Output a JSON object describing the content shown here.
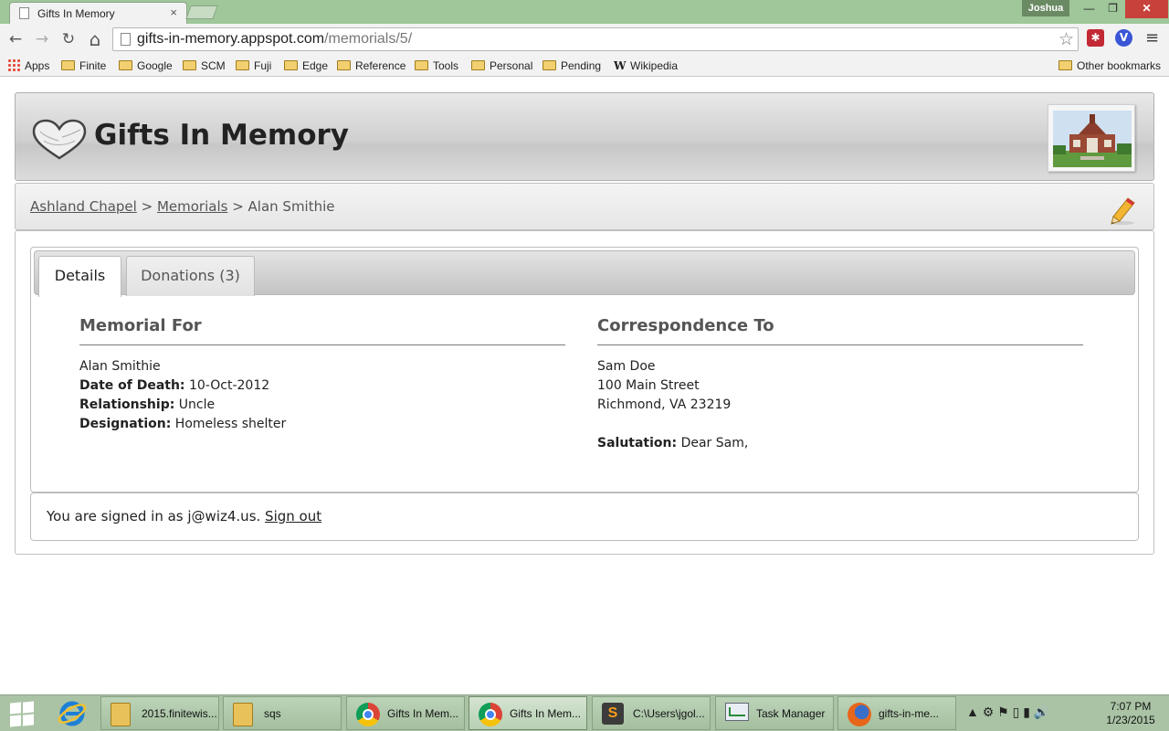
{
  "browser": {
    "tab_title": "Gifts In Memory",
    "tab_close": "×",
    "user": "Joshua",
    "window_controls": {
      "minimize": "—",
      "maximize": "❐",
      "close": "✕"
    },
    "nav": {
      "back": "←",
      "forward": "→",
      "reload": "↻",
      "home": "⌂"
    },
    "url_host": "gifts-in-memory.appspot.com",
    "url_path": "/memorials/5/",
    "star": "☆",
    "ext_red": "✱",
    "ext_blue": "V",
    "menu": "≡"
  },
  "bookmarks": {
    "apps": "Apps",
    "items": [
      "Finite",
      "Google",
      "SCM",
      "Fuji",
      "Edge",
      "Reference",
      "Tools",
      "Personal",
      "Pending"
    ],
    "wikipedia": "Wikipedia",
    "other": "Other bookmarks"
  },
  "header": {
    "title": "Gifts In Memory"
  },
  "breadcrumb": {
    "org": "Ashland Chapel",
    "sep1": " > ",
    "section": "Memorials",
    "sep2": " > ",
    "current": "Alan Smithie"
  },
  "tabs": {
    "details": "Details",
    "donations": "Donations (3)"
  },
  "memorial": {
    "heading": "Memorial For",
    "name": "Alan Smithie",
    "date_of_death_label": "Date of Death:",
    "date_of_death": " 10-Oct-2012",
    "relationship_label": "Relationship:",
    "relationship": " Uncle",
    "designation_label": "Designation:",
    "designation": " Homeless shelter"
  },
  "correspondence": {
    "heading": "Correspondence To",
    "name": "Sam Doe",
    "street": "100 Main Street",
    "city_state_zip": "Richmond, VA 23219",
    "salutation_label": "Salutation:",
    "salutation": " Dear Sam,"
  },
  "signin": {
    "text": "You are signed in as j@wiz4.us. ",
    "signout": "Sign out"
  },
  "taskbar": {
    "items": [
      "2015.finitewis...",
      "sqs",
      "Gifts In Mem...",
      "Gifts In Mem...",
      "C:\\Users\\jgol...",
      "Task Manager",
      "gifts-in-me..."
    ],
    "time": "7:07 PM",
    "date": "1/23/2015",
    "tray": "▲ ⚙ ⚑ ▯ ▮ 🔊"
  }
}
